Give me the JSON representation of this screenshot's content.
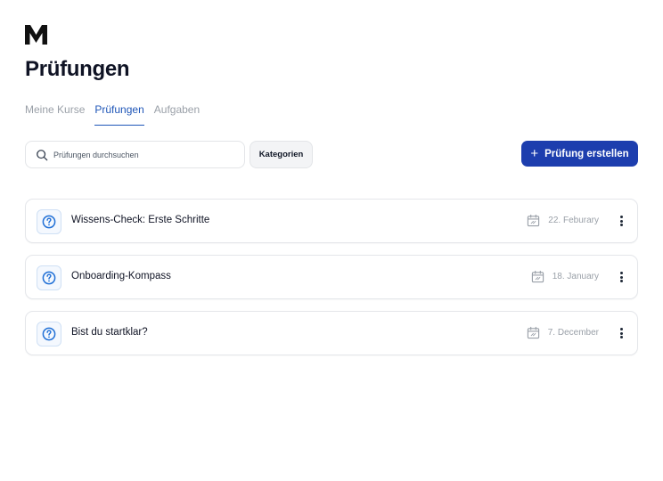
{
  "header": {
    "title": "Prüfungen"
  },
  "tabs": [
    {
      "label": "Meine Kurse",
      "active": false
    },
    {
      "label": "Prüfungen",
      "active": true
    },
    {
      "label": "Aufgaben",
      "active": false
    }
  ],
  "toolbar": {
    "search_placeholder": "Prüfungen durchsuchen",
    "categories_label": "Kategorien",
    "create_label": "Prüfung erstellen"
  },
  "exams": [
    {
      "title": "Wissens-Check: Erste Schritte",
      "date": "22. Feburary"
    },
    {
      "title": "Onboarding-Kompass",
      "date": "18. January"
    },
    {
      "title": "Bist du startklar?",
      "date": "7. December"
    }
  ],
  "colors": {
    "accent": "#1d3eae",
    "active_tab": "#1f56b8",
    "icon_blue": "#1f6fd6"
  },
  "icons": {
    "logo": "m-logo",
    "search": "search-icon",
    "create": "plus-icon",
    "exam": "question-circle-icon",
    "date": "calendar-icon",
    "more": "more-vertical-icon"
  }
}
